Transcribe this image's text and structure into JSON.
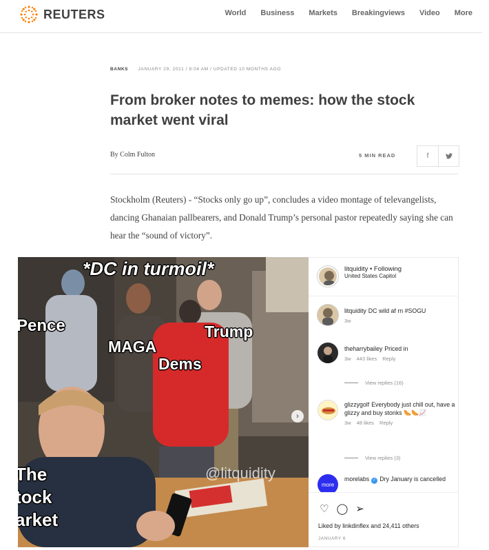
{
  "header": {
    "brand": "REUTERS",
    "nav": [
      "World",
      "Business",
      "Markets",
      "Breakingviews",
      "Video",
      "More"
    ]
  },
  "article": {
    "kicker": "BANKS",
    "dateline": "JANUARY 29, 2021 / 8:04 AM / UPDATED 10 MONTHS AGO",
    "headline": "From broker notes to memes: how the stock market went viral",
    "byline": "By Colm Fulton",
    "read_time": "5 MIN READ",
    "share": {
      "facebook": "f",
      "twitter": "🐦"
    },
    "lede": "Stockholm (Reuters) - “Stocks only go up”, concludes a video montage of televangelists, dancing Ghanaian pallbearers, and Donald Trump’s personal pastor repeatedly saying she can hear the “sound of victory”."
  },
  "embed": {
    "meme": {
      "title": "*DC in turmoil*",
      "pence": "Pence",
      "maga": "MAGA",
      "trump": "Trump",
      "dems": "Dems",
      "market": "The\ntock\narket",
      "watermark": "@litquidity"
    },
    "post": {
      "username": "litquidity",
      "follow": "• Following",
      "location": "United States Capitol"
    },
    "comments": [
      {
        "user": "litquidity",
        "text": "DC wild af rn #SOGU",
        "age": "3w"
      },
      {
        "user": "theharrybailey",
        "text": "Priced in",
        "age": "3w",
        "likes": "443 likes",
        "reply": "Reply",
        "replies": "View replies (16)"
      },
      {
        "user": "glizzygolf",
        "text": "Everybody just chill out, have a glizzy and buy stonks 🌭🌭📈",
        "age": "3w",
        "likes": "48 likes",
        "reply": "Reply",
        "replies": "View replies (3)"
      },
      {
        "user": "morelabs",
        "text": "Dry January is cancelled"
      }
    ],
    "liked_by": "Liked by linkdinflex and 24,411 others",
    "date": "JANUARY 6",
    "colors": {
      "accent": "#ff8000",
      "verified": "#3897f0",
      "link": "#00376b"
    }
  }
}
